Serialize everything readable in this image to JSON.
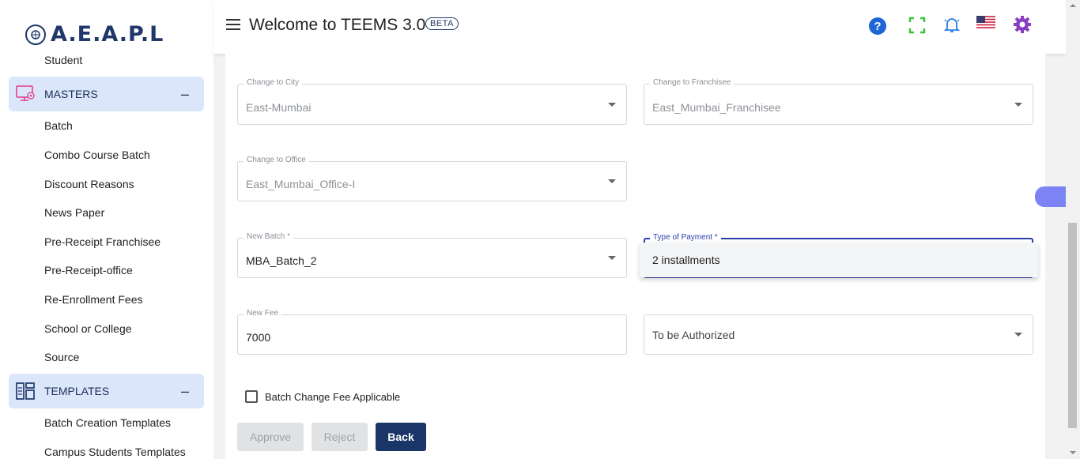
{
  "sidebar": {
    "logo_text": "A.E.A.P.L",
    "top_partial_item": "Student",
    "masters": {
      "label": "MASTERS",
      "toggle": "–",
      "items": [
        "Batch",
        "Combo Course Batch",
        "Discount Reasons",
        "News Paper",
        "Pre-Receipt Franchisee",
        "Pre-Receipt-office",
        "Re-Enrollment Fees",
        "School or College",
        "Source"
      ]
    },
    "templates": {
      "label": "TEMPLATES",
      "toggle": "–",
      "items": [
        "Batch Creation Templates",
        "Campus Students Templates"
      ]
    }
  },
  "header": {
    "title": "Welcome to TEEMS 3.0",
    "badge": "BETA",
    "icons": [
      "help-icon",
      "fullscreen-icon",
      "notification-bell-icon",
      "us-flag-icon",
      "settings-gear-icon"
    ]
  },
  "form": {
    "city": {
      "label": "Change to City",
      "value": "East-Mumbai"
    },
    "franchisee": {
      "label": "Change to Franchisee",
      "value": "East_Mumbai_Franchisee"
    },
    "office": {
      "label": "Change to Office",
      "value": "East_Mumbai_Office-I"
    },
    "new_batch": {
      "label": "New Batch *",
      "value": "MBA_Batch_2"
    },
    "payment_type": {
      "label": "Type of Payment *",
      "options": [
        "2 installments"
      ]
    },
    "new_fee": {
      "label": "New Fee",
      "value": "7000"
    },
    "authorization": {
      "value": "To be Authorized"
    },
    "batch_change_fee": {
      "label": "Batch Change Fee Applicable",
      "checked": false
    }
  },
  "buttons": {
    "approve": "Approve",
    "reject": "Reject",
    "back": "Back"
  },
  "colors": {
    "accent": "#2b3ea8",
    "brand": "#1f3769",
    "primary_button": "#1a3668",
    "section_bg": "#dbe6fb"
  }
}
